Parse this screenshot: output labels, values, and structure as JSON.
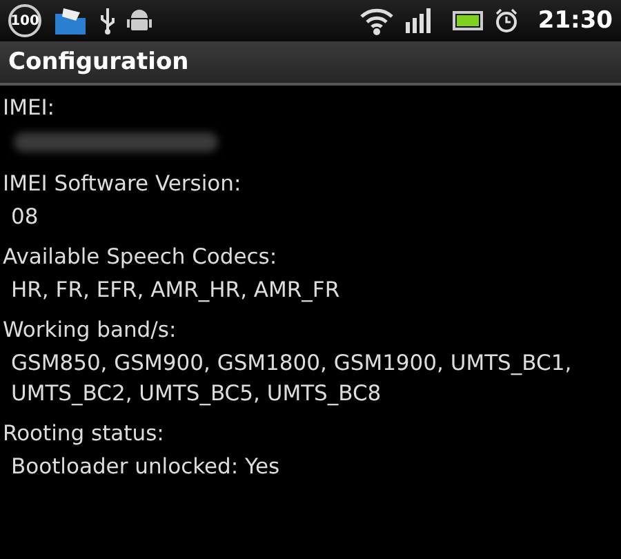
{
  "status_bar": {
    "badge": "100",
    "time": "21:30"
  },
  "title": "Configuration",
  "sections": [
    {
      "label": "IMEI:",
      "redacted": true
    },
    {
      "label": "IMEI Software Version:",
      "value": "08"
    },
    {
      "label": "Available Speech Codecs:",
      "value": "HR, FR, EFR, AMR_HR, AMR_FR"
    },
    {
      "label": "Working band/s:",
      "value": "GSM850, GSM900, GSM1800, GSM1900, UMTS_BC1, UMTS_BC2, UMTS_BC5, UMTS_BC8"
    },
    {
      "label": "Rooting status:",
      "value": "Bootloader unlocked: Yes"
    }
  ]
}
